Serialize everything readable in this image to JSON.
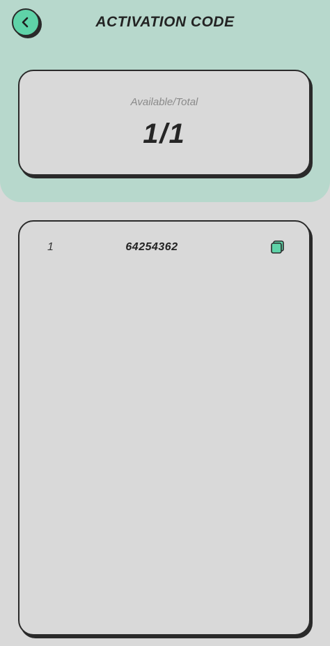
{
  "header": {
    "title": "ACTIVATION CODE",
    "back_icon": "chevron-left-icon"
  },
  "summary": {
    "label": "Available/Total",
    "value": "1/1"
  },
  "codes": [
    {
      "index": "1",
      "code": "64254362",
      "copy_icon": "copy-icon"
    }
  ],
  "colors": {
    "accent": "#5fd3a8",
    "header_bg": "#b7d8cc",
    "page_bg": "#d9d9d9",
    "outline": "#2a2a2a"
  }
}
